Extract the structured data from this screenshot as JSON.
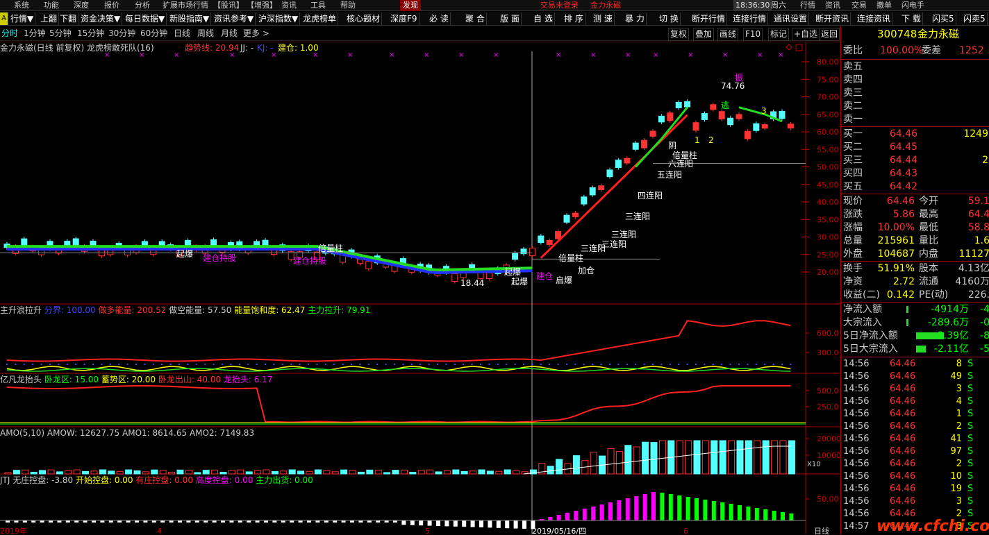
{
  "menu": {
    "items": [
      "系统",
      "功能",
      "深度",
      "报价",
      "分析",
      "扩展市场行情",
      "【股讯】",
      "【增强】",
      "资讯",
      "工具",
      "帮助",
      "发现"
    ],
    "status_red": "交易未登录",
    "status_red2": "金力永磁",
    "clock": "18:36:30",
    "weekday": "周六",
    "right_items": [
      "行情",
      "资讯",
      "交易",
      "撤单",
      "闪电手"
    ]
  },
  "toolbar": {
    "items": [
      "行情▼",
      "上翻",
      "下翻",
      "资金决策▼",
      "每日数据▼",
      "新股指南▼",
      "资讯参考▼",
      "沪深指数▼",
      "龙虎榜单",
      "核心题材",
      "深度F9",
      "必 读",
      "聚 合",
      "版 面",
      "自 选",
      "排 序",
      "测 速",
      "暴 力",
      "切 换",
      "断开行情",
      "连接行情",
      "通讯设置",
      "断开资讯",
      "连接资讯",
      "下 载",
      "闪买5",
      "闪卖5"
    ]
  },
  "periods": {
    "items": [
      "分时",
      "1分钟",
      "5分钟",
      "15分钟",
      "30分钟",
      "60分钟",
      "日线",
      "周线",
      "月线",
      "更多 >"
    ],
    "active": "分时",
    "buttons": [
      "复权",
      "叠加",
      "画线",
      "F10",
      "标记",
      "+自选",
      "返回"
    ]
  },
  "main_panel": {
    "title": "金力永磁(日线 前复权) 龙虎榜敢死队(16)",
    "trend_label": "趋势线: 20.94",
    "jj": "JJ: -",
    "kj": "KJ: -",
    "jiancang": "建仓: 1.00",
    "y_ticks": [
      "80.00",
      "75.00",
      "70.00",
      "65.00",
      "60.00",
      "55.00",
      "50.00",
      "45.00",
      "40.00",
      "35.00",
      "30.00",
      "25.00",
      "20.00"
    ],
    "annotations": [
      {
        "t": "倍量柱",
        "c": "#fff"
      },
      {
        "t": "起爆",
        "c": "#fff"
      },
      {
        "t": "建仓持股",
        "c": "#f0f"
      },
      {
        "t": "建仓持股",
        "c": "#f0f"
      },
      {
        "t": "起爆",
        "c": "#fff"
      },
      {
        "t": "起爆",
        "c": "#fff"
      },
      {
        "t": "建仓",
        "c": "#f0f"
      },
      {
        "t": "启爆",
        "c": "#fff"
      },
      {
        "t": "18.44",
        "c": "#fff"
      },
      {
        "t": "加仓",
        "c": "#fff"
      },
      {
        "t": "倍量柱",
        "c": "#fff"
      },
      {
        "t": "三连阳",
        "c": "#fff"
      },
      {
        "t": "三连阳",
        "c": "#fff"
      },
      {
        "t": "三连阳",
        "c": "#fff"
      },
      {
        "t": "三连阳",
        "c": "#fff"
      },
      {
        "t": "四连阳",
        "c": "#fff"
      },
      {
        "t": "五连阳",
        "c": "#fff"
      },
      {
        "t": "六连阳",
        "c": "#fff"
      },
      {
        "t": "74.76",
        "c": "#fff"
      },
      {
        "t": "振",
        "c": "#f0f"
      },
      {
        "t": "逃",
        "c": "#0f0"
      },
      {
        "t": "倍量柱",
        "c": "#fff"
      },
      {
        "t": "1",
        "c": "#ff0"
      },
      {
        "t": "2",
        "c": "#ff0"
      },
      {
        "t": "3",
        "c": "#ff0"
      },
      {
        "t": "阴",
        "c": "#fff"
      }
    ]
  },
  "ind1": {
    "name": "主升浪拉升",
    "fields": [
      {
        "t": "分界: 100.00",
        "c": "#44f"
      },
      {
        "t": "做多能量: 200.52",
        "c": "#f33"
      },
      {
        "t": "做空能量: 57.50",
        "c": "#ccc"
      },
      {
        "t": "能量饱和度: 62.47",
        "c": "#ff0"
      },
      {
        "t": "主力拉升: 79.91",
        "c": "#0f0"
      }
    ],
    "y_ticks": [
      "600.0",
      "300.0"
    ]
  },
  "ind2": {
    "name": "亿凡龙抬头",
    "fields": [
      {
        "t": "卧龙区: 15.00",
        "c": "#0f0"
      },
      {
        "t": "蓄势区: 20.00",
        "c": "#ff0"
      },
      {
        "t": "卧龙出山: 40.00",
        "c": "#f33"
      },
      {
        "t": "龙抬头: 6.17",
        "c": "#f0f"
      }
    ],
    "y_ticks": [
      "500.0",
      "250.0"
    ]
  },
  "ind3": {
    "name": "AMO(5,10)",
    "fields": [
      {
        "t": "AMOW: 12627.75",
        "c": "#ccc"
      },
      {
        "t": "AMO1: 8614.65",
        "c": "#ccc"
      },
      {
        "t": "AMO2: 7149.83",
        "c": "#ccc"
      }
    ],
    "y_ticks": [
      "20000",
      "10000"
    ],
    "unit": "X10"
  },
  "ind4": {
    "name": "JTJ",
    "fields": [
      {
        "t": "无庄控盘: -3.80",
        "c": "#ccc"
      },
      {
        "t": "开始控盘: 0.00",
        "c": "#ff0"
      },
      {
        "t": "有庄控盘: 0.00",
        "c": "#f33"
      },
      {
        "t": "高度控盘: 0.00",
        "c": "#f0f"
      },
      {
        "t": "主力出货: 0.00",
        "c": "#0f0"
      }
    ],
    "y_ticks": [
      "50.00"
    ]
  },
  "xaxis": {
    "labels": [
      "2019年",
      "4",
      "5",
      "2019/05/16/四",
      "6"
    ],
    "right_label": "日线"
  },
  "quote": {
    "code": "300748",
    "name": "金力永磁",
    "webi": "委比",
    "webi_v": "100.00%",
    "wecha": "委差",
    "wecha_v": "1252",
    "sell": [
      {
        "l": "卖五",
        "p": "",
        "v": ""
      },
      {
        "l": "卖四",
        "p": "",
        "v": ""
      },
      {
        "l": "卖三",
        "p": "",
        "v": ""
      },
      {
        "l": "卖二",
        "p": "",
        "v": ""
      },
      {
        "l": "卖一",
        "p": "",
        "v": ""
      }
    ],
    "buy": [
      {
        "l": "买一",
        "p": "64.46",
        "v": "1249"
      },
      {
        "l": "买二",
        "p": "64.45",
        "v": ""
      },
      {
        "l": "买三",
        "p": "64.44",
        "v": "2"
      },
      {
        "l": "买四",
        "p": "64.43",
        "v": ""
      },
      {
        "l": "买五",
        "p": "64.42",
        "v": ""
      }
    ],
    "stats": [
      {
        "a": "现价",
        "av": "64.46",
        "b": "今开",
        "bv": "59.1"
      },
      {
        "a": "涨跌",
        "av": "5.86",
        "b": "最高",
        "bv": "64.4"
      },
      {
        "a": "涨幅",
        "av": "10.00%",
        "b": "最低",
        "bv": "58.8"
      },
      {
        "a": "总量",
        "av": "215961",
        "b": "量比",
        "bv": "1.6"
      },
      {
        "a": "外盘",
        "av": "104687",
        "b": "内盘",
        "bv": "11127"
      }
    ],
    "stats2": [
      {
        "a": "换手",
        "av": "51.91%",
        "b": "股本",
        "bv": "4.13亿"
      },
      {
        "a": "净资",
        "av": "2.72",
        "b": "流通",
        "bv": "4160万"
      },
      {
        "a": "收益(二)",
        "av": "0.142",
        "b": "PE(动)",
        "bv": "226."
      }
    ],
    "flow": [
      {
        "l": "净流入额",
        "v": "-4914万",
        "p": "-4"
      },
      {
        "l": "大宗流入",
        "v": "-289.6万",
        "p": "-0"
      },
      {
        "l": "5日净流入额",
        "v": "-3.39亿",
        "p": "-8"
      },
      {
        "l": "5日大宗流入",
        "v": "-2.11亿",
        "p": "-5"
      }
    ],
    "ticks": [
      {
        "t": "14:56",
        "p": "64.46",
        "v": "8",
        "s": "S"
      },
      {
        "t": "14:56",
        "p": "64.46",
        "v": "49",
        "s": "S"
      },
      {
        "t": "14:56",
        "p": "64.46",
        "v": "3",
        "s": "S"
      },
      {
        "t": "14:56",
        "p": "64.46",
        "v": "4",
        "s": "S"
      },
      {
        "t": "14:56",
        "p": "64.46",
        "v": "1",
        "s": "S"
      },
      {
        "t": "14:56",
        "p": "64.46",
        "v": "2",
        "s": "S"
      },
      {
        "t": "14:56",
        "p": "64.46",
        "v": "41",
        "s": "S"
      },
      {
        "t": "14:56",
        "p": "64.46",
        "v": "97",
        "s": "S"
      },
      {
        "t": "14:56",
        "p": "64.46",
        "v": "2",
        "s": "S"
      },
      {
        "t": "14:56",
        "p": "64.46",
        "v": "10",
        "s": "S"
      },
      {
        "t": "14:56",
        "p": "64.46",
        "v": "19",
        "s": "S"
      },
      {
        "t": "14:56",
        "p": "64.46",
        "v": "3",
        "s": "S"
      },
      {
        "t": "14:56",
        "p": "64.46",
        "v": "2",
        "s": "S"
      },
      {
        "t": "14:57",
        "p": "64.46",
        "v": "3",
        "s": "S"
      }
    ]
  },
  "watermark": "www.cfchi.com",
  "colors": {
    "up": "#ff3232",
    "down": "#54ffff",
    "bg": "#000000",
    "grid": "#a00000",
    "axis": "#c00000"
  }
}
